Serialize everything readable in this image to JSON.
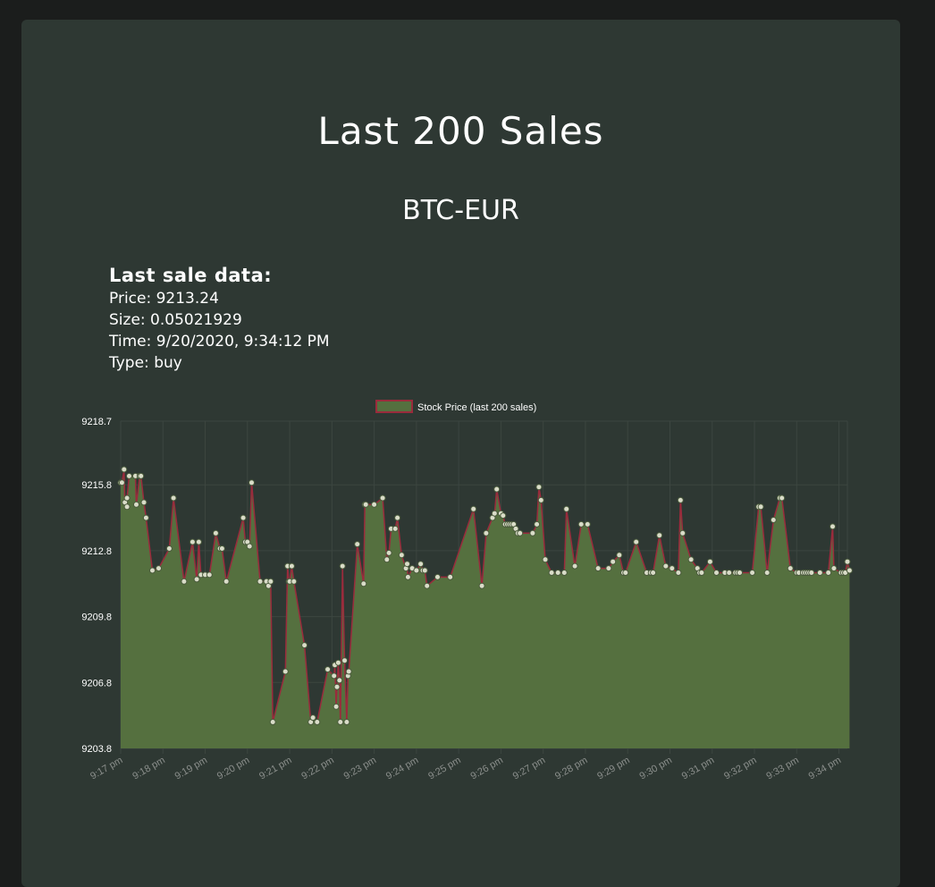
{
  "page": {
    "title": "Last 200 Sales",
    "subtitle": "BTC-EUR"
  },
  "last_sale": {
    "heading": "Last sale data:",
    "price_label": "Price:",
    "price": "9213.24",
    "size_label": "Size:",
    "size": "0.05021929",
    "time_label": "Time:",
    "time": "9/20/2020, 9:34:12 PM",
    "type_label": "Type:",
    "type": "buy"
  },
  "colors": {
    "background": "#1b1d1c",
    "card": "#2e3833",
    "area_fill": "#55703f",
    "line": "#9a2b3c",
    "point_fill": "#d9dcc8",
    "grid": "#3c4640",
    "tick_y": "#ffffff",
    "tick_x": "#8b8f8c"
  },
  "chart_data": {
    "type": "area",
    "legend": {
      "label": "Stock Price (last 200 sales)",
      "position": "top"
    },
    "ylim": [
      9203.8,
      9218.7
    ],
    "y_ticks": [
      "9218.7",
      "9215.8",
      "9212.8",
      "9209.8",
      "9206.8",
      "9203.8"
    ],
    "x_ticks": [
      "9:17 pm",
      "9:18 pm",
      "9:19 pm",
      "9:20 pm",
      "9:21 pm",
      "9:22 pm",
      "9:23 pm",
      "9:24 pm",
      "9:25 pm",
      "9:26 pm",
      "9:27 pm",
      "9:28 pm",
      "9:29 pm",
      "9:30 pm",
      "9:31 pm",
      "9:32 pm",
      "9:33 pm",
      "9:34 pm"
    ],
    "xlim": [
      "9:17 pm",
      "9:34:12 pm"
    ],
    "grid": true,
    "x_minutes": [
      0.0,
      0.03,
      0.08,
      0.1,
      0.15,
      0.15,
      0.2,
      0.35,
      0.37,
      0.45,
      0.48,
      0.55,
      0.6,
      0.75,
      0.9,
      1.15,
      1.25,
      1.5,
      1.7,
      1.8,
      1.85,
      1.9,
      2.0,
      2.1,
      2.25,
      2.35,
      2.4,
      2.5,
      2.9,
      2.95,
      3.0,
      3.05,
      3.1,
      3.3,
      3.45,
      3.5,
      3.55,
      3.6,
      3.9,
      3.95,
      3.98,
      4.0,
      4.05,
      4.1,
      4.35,
      4.5,
      4.55,
      4.65,
      4.9,
      5.05,
      5.07,
      5.1,
      5.12,
      5.15,
      5.18,
      5.2,
      5.25,
      5.3,
      5.35,
      5.38,
      5.4,
      5.6,
      5.75,
      5.78,
      5.8,
      6.0,
      6.2,
      6.3,
      6.35,
      6.4,
      6.5,
      6.55,
      6.65,
      6.75,
      6.78,
      6.8,
      6.9,
      7.0,
      7.1,
      7.15,
      7.2,
      7.25,
      7.5,
      7.8,
      8.35,
      8.55,
      8.65,
      8.8,
      8.85,
      8.9,
      9.0,
      9.05,
      9.1,
      9.15,
      9.2,
      9.25,
      9.3,
      9.35,
      9.4,
      9.45,
      9.75,
      9.85,
      9.9,
      9.95,
      10.05,
      10.2,
      10.35,
      10.5,
      10.55,
      10.75,
      10.9,
      11.05,
      11.3,
      11.55,
      11.65,
      11.8,
      11.9,
      11.95,
      12.2,
      12.45,
      12.55,
      12.6,
      12.75,
      12.9,
      13.05,
      13.2,
      13.25,
      13.3,
      13.5,
      13.65,
      13.7,
      13.75,
      13.95,
      14.1,
      14.3,
      14.4,
      14.55,
      14.6,
      14.65,
      14.95,
      15.1,
      15.15,
      15.3,
      15.45,
      15.6,
      15.65,
      15.85,
      16.0,
      16.05,
      16.15,
      16.2,
      16.25,
      16.3,
      16.35,
      16.55,
      16.75,
      16.85,
      16.88,
      17.05,
      17.1,
      17.15,
      17.2,
      17.25
    ],
    "values": [
      9215.9,
      9215.9,
      9216.5,
      9215.0,
      9214.8,
      9215.2,
      9216.2,
      9216.2,
      9214.9,
      9216.2,
      9216.2,
      9215.0,
      9214.3,
      9211.9,
      9212.0,
      9212.9,
      9215.2,
      9211.4,
      9213.2,
      9211.5,
      9213.2,
      9211.7,
      9211.7,
      9211.7,
      9213.6,
      9212.9,
      9212.9,
      9211.4,
      9214.3,
      9213.2,
      9213.2,
      9213.0,
      9215.9,
      9211.4,
      9211.4,
      9211.2,
      9211.4,
      9205.0,
      9207.3,
      9212.1,
      9211.4,
      9211.4,
      9212.1,
      9211.4,
      9208.5,
      9205.0,
      9205.2,
      9205.0,
      9207.4,
      9207.1,
      9207.6,
      9205.7,
      9206.6,
      9207.7,
      9206.9,
      9205.0,
      9212.1,
      9207.8,
      9205.0,
      9207.1,
      9207.3,
      9213.1,
      9211.3,
      9214.9,
      9214.9,
      9214.9,
      9215.2,
      9212.4,
      9212.7,
      9213.8,
      9213.8,
      9214.3,
      9212.6,
      9212.0,
      9212.2,
      9211.6,
      9212.0,
      9211.9,
      9212.2,
      9211.9,
      9211.9,
      9211.2,
      9211.6,
      9211.6,
      9214.7,
      9211.2,
      9213.6,
      9214.3,
      9214.5,
      9215.6,
      9214.5,
      9214.4,
      9214.0,
      9214.0,
      9214.0,
      9214.0,
      9214.0,
      9213.8,
      9213.6,
      9213.6,
      9213.6,
      9214.0,
      9215.7,
      9215.1,
      9212.4,
      9211.8,
      9211.8,
      9211.8,
      9214.7,
      9212.1,
      9214.0,
      9214.0,
      9212.0,
      9212.0,
      9212.3,
      9212.6,
      9211.8,
      9211.8,
      9213.2,
      9211.8,
      9211.8,
      9211.8,
      9213.5,
      9212.1,
      9212.0,
      9211.8,
      9215.1,
      9213.6,
      9212.4,
      9212.0,
      9211.8,
      9211.8,
      9212.3,
      9211.8,
      9211.8,
      9211.8,
      9211.8,
      9211.8,
      9211.8,
      9211.8,
      9214.8,
      9214.8,
      9211.8,
      9214.2,
      9215.2,
      9215.2,
      9212.0,
      9211.8,
      9211.8,
      9211.8,
      9211.8,
      9211.8,
      9211.8,
      9211.8,
      9211.8,
      9211.8,
      9213.9,
      9212.0,
      9211.8,
      9211.8,
      9211.8,
      9212.3,
      9211.9,
      9214.1,
      9215.3,
      9215.4,
      9215.5,
      9215.6,
      9215.5,
      9211.9,
      9211.9,
      9213.6,
      9213.6,
      9212.2,
      9212.2,
      9213.4,
      9213.4,
      9212.9,
      9212.9,
      9211.8,
      9211.8,
      9211.8,
      9213.6,
      9213.6,
      9213.0,
      9213.0,
      9212.9,
      9213.24
    ]
  }
}
